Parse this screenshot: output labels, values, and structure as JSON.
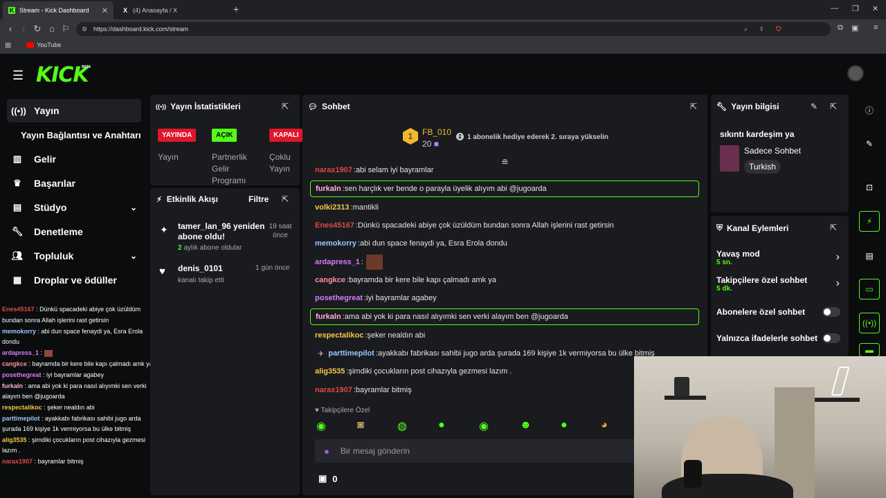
{
  "browser": {
    "tabs": [
      {
        "title": "Stream - Kick Dashboard",
        "icon": "K"
      },
      {
        "title": "(4) Anasayfa / X",
        "icon": "X"
      }
    ],
    "url": "https://dashboard.kick.com/stream",
    "bookmark": "YouTube"
  },
  "header": {
    "logo": "KICK",
    "beta": "BETA"
  },
  "sidebar": {
    "items": [
      {
        "label": "Yayın",
        "icon": "broadcast-icon"
      },
      {
        "label": "Yayın Bağlantısı ve Anahtarı",
        "icon": ""
      },
      {
        "label": "Gelir",
        "icon": "chart-icon"
      },
      {
        "label": "Başarılar",
        "icon": "trophy-icon"
      },
      {
        "label": "Stüdyo",
        "icon": "studio-icon"
      },
      {
        "label": "Denetleme",
        "icon": "wrench-icon"
      },
      {
        "label": "Topluluk",
        "icon": "people-icon"
      },
      {
        "label": "Droplar ve ödüller",
        "icon": "drops-icon"
      }
    ],
    "chat": [
      {
        "user": "Enes45167",
        "text": "Dünkü spacadeki abiye çok üzüldüm",
        "color": "#e04848"
      },
      {
        "user": "",
        "text": "bundan sonra Allah işlerini rast getirsin",
        "color": "#fff"
      },
      {
        "user": "memokorry",
        "text": "abi dun space fenaydi ya, Esra Erola dondu",
        "color": "#9ec5ff"
      },
      {
        "user": "ardapress_1",
        "text": "",
        "color": "#d77bff"
      },
      {
        "user": "cangkce",
        "text": "bayramda bir kere bile kapı çalmadı amk ya",
        "color": "#ff8fa0"
      },
      {
        "user": "posethegreat",
        "text": "iyi bayramlar agabey",
        "color": "#d77bff"
      },
      {
        "user": "furkaln",
        "text": "ama abi yok ki para nasıl alıyımki sen verki alayım ben @jugoarda",
        "color": "#ffb3d9"
      },
      {
        "user": "respectalikoc",
        "text": "şeker nealdın abi",
        "color": "#f2c94c"
      },
      {
        "user": "parttimepilot",
        "text": "ayakkabı fabrikası sahibi jugo arda şurada 169 kişiye 1k vermiyorsa bu ülke bitmiş",
        "color": "#9ec5ff"
      },
      {
        "user": "alig3535",
        "text": "şimdiki çocukların post cihazıyla gezmesi lazım .",
        "color": "#f2c94c"
      },
      {
        "user": "narax1907",
        "text": "bayramlar bitmiş",
        "color": "#e04848"
      }
    ]
  },
  "stats": {
    "title": "Yayın İstatistikleri",
    "items": [
      {
        "badge": "YAYINDA",
        "label": "Yayın",
        "badge_color": "#e0162b"
      },
      {
        "badge": "AÇIK",
        "label": "Partnerlik Gelir Programı",
        "badge_color": "#53fc18"
      },
      {
        "badge": "KAPALI",
        "label": "Çoklu Yayın",
        "badge_color": "#e0162b"
      }
    ]
  },
  "activity": {
    "title": "Etkinlik Akışı",
    "filter": "Filtre",
    "events": [
      {
        "user": "tamer_lan_96 yeniden abone oldu!",
        "time": "19 saat önce",
        "highlight": "2",
        "detail": "aylık abone oldular"
      },
      {
        "user": "denis_0101",
        "time": "1 gün önce",
        "detail": "kanalı takip etti"
      }
    ]
  },
  "chat": {
    "title": "Sohbet",
    "leader": {
      "rank": "1",
      "name": "FB_010",
      "count": "20"
    },
    "promo_num": "2",
    "promo": "1 abonelik hediye ederek 2. sıraya yükselin",
    "messages": [
      {
        "user": "narax1907",
        "text": "abi selam iyi bayramlar",
        "color": "#e04848"
      },
      {
        "user": "furkaln",
        "text": "sen harçlık ver bende o parayla üyelik alıyım abi @jugoarda",
        "color": "#ffb3d9",
        "hl": true
      },
      {
        "user": "volki2313",
        "text": "mantikli",
        "color": "#f2c94c"
      },
      {
        "user": "Enes45167",
        "text": "Dünkü spacadeki abiye çok üzüldüm bundan sonra Allah işlerini rast getirsin",
        "color": "#e04848"
      },
      {
        "user": "memokorry",
        "text": "abi dun space fenaydi ya, Esra Erola dondu",
        "color": "#9ec5ff"
      },
      {
        "user": "ardapress_1",
        "text": "",
        "color": "#d77bff"
      },
      {
        "user": "cangkce",
        "text": "bayramda bir kere bile kapı çalmadı amk ya",
        "color": "#ff8fa0"
      },
      {
        "user": "posethegreat",
        "text": "iyi bayramlar agabey",
        "color": "#d77bff"
      },
      {
        "user": "furkaln",
        "text": "ama abi yok ki para nasıl alıyımki sen verki alayım ben @jugoarda",
        "color": "#ffb3d9",
        "hl": true
      },
      {
        "user": "respectalikoc",
        "text": "şeker nealdın abi",
        "color": "#f2c94c"
      },
      {
        "user": "parttimepilot",
        "text": "ayakkabı fabrikası sahibi jugo arda şurada 169 kişiye 1k vermiyorsa bu ülke bitmiş",
        "color": "#9ec5ff"
      },
      {
        "user": "alig3535",
        "text": "şimdiki çocukların post cihazıyla gezmesi lazım .",
        "color": "#f2c94c"
      },
      {
        "user": "narax1907",
        "text": "bayramlar bitmiş",
        "color": "#e04848"
      }
    ],
    "followers_label": "Takipçilere Özel",
    "input_placeholder": "Bir mesaj gönderin",
    "store_count": "0"
  },
  "info": {
    "title": "Yayın bilgisi",
    "stream_title": "sıkıntı kardeşim ya",
    "category": "Sadece Sohbet",
    "language": "Turkish"
  },
  "channel": {
    "title": "Kanal Eylemleri",
    "items": [
      {
        "label": "Yavaş mod",
        "value": "5 sn."
      },
      {
        "label": "Takipçilere özel sohbet",
        "value": "5 dk."
      },
      {
        "label": "Abonelere özel sohbet"
      },
      {
        "label": "Yalnızca ifadelerle sohbet"
      }
    ]
  }
}
